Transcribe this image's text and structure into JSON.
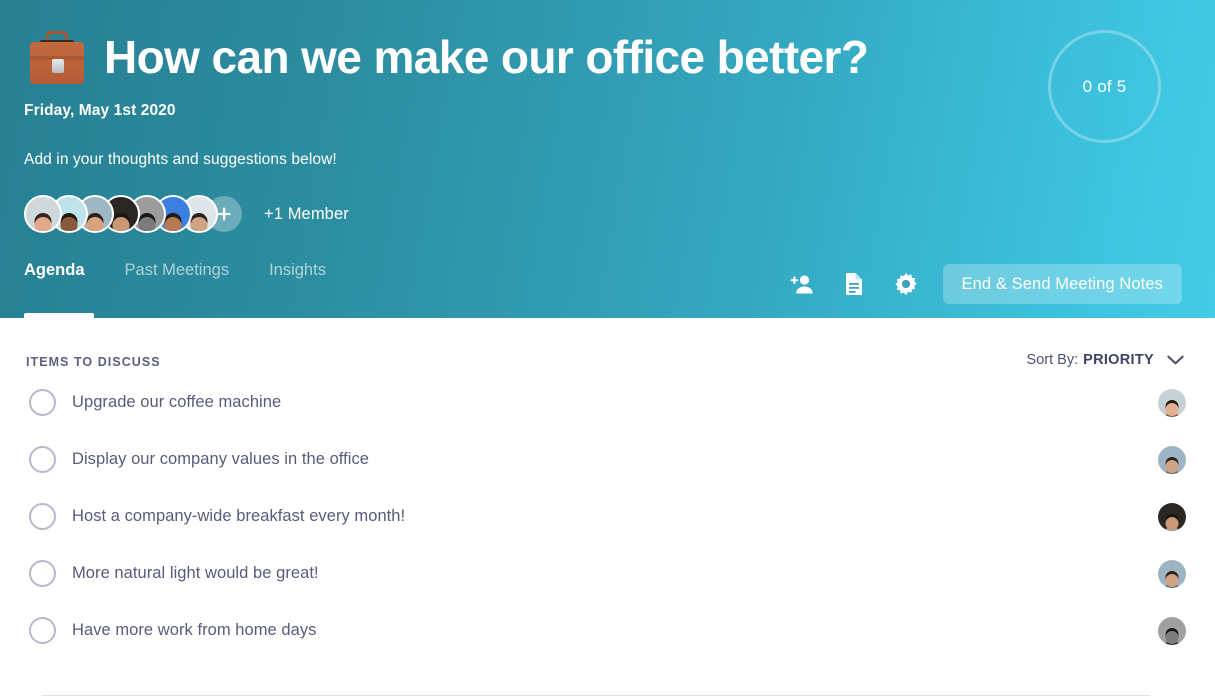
{
  "header": {
    "icon": "briefcase-icon",
    "title": "How can we make our office better?",
    "date": "Friday, May 1st 2020",
    "subtitle": "Add in your thoughts and suggestions below!",
    "progress_badge": "0 of 5",
    "members_count_label": "+1 Member",
    "add_member_icon": "plus-icon",
    "members": [
      {
        "name": "member-avatar-1",
        "skin": "#e0a98a",
        "hair": "#33261f",
        "shirt": "#a0785f",
        "bg": "#cfd8da"
      },
      {
        "name": "member-avatar-2",
        "skin": "#8a5a3c",
        "hair": "#241a14",
        "shirt": "#1f4f96",
        "bg": "#bfe3ea"
      },
      {
        "name": "member-avatar-3",
        "skin": "#d9a27c",
        "hair": "#2c2119",
        "shirt": "#6b6f73",
        "bg": "#9fb7c4"
      },
      {
        "name": "member-avatar-4",
        "skin": "#c99977",
        "hair": "#1c1611",
        "shirt": "#9aa2a8",
        "bg": "#2a2622"
      },
      {
        "name": "member-avatar-5",
        "skin": "#7b7b7b",
        "hair": "#1a1a1a",
        "shirt": "#2e2e2e",
        "bg": "#9c9c9c"
      },
      {
        "name": "member-avatar-6",
        "skin": "#b57a52",
        "hair": "#231a13",
        "shirt": "#2a6fd6",
        "bg": "#3c7fe0"
      },
      {
        "name": "member-avatar-7",
        "skin": "#cfa384",
        "hair": "#2a211c",
        "shirt": "#4a5258",
        "bg": "#dfe6ea"
      }
    ]
  },
  "tabs": [
    {
      "label": "Agenda",
      "active": true
    },
    {
      "label": "Past Meetings",
      "active": false
    },
    {
      "label": "Insights",
      "active": false
    }
  ],
  "toolbar": {
    "add_person_icon": "person-add-icon",
    "notes_icon": "document-icon",
    "settings_icon": "gear-icon",
    "end_send_label": "End & Send Meeting Notes"
  },
  "content": {
    "section_label": "ITEMS TO DISCUSS",
    "sort_label": "Sort By:",
    "sort_value": "PRIORITY",
    "sort_chevron_icon": "chevron-down-icon",
    "items": [
      {
        "text": "Upgrade our coffee machine",
        "checked": false,
        "avatar": {
          "skin": "#e3b091",
          "hair": "#241813",
          "shirt": "#7a5c49",
          "bg": "#c6d2d6"
        }
      },
      {
        "text": "Display our company values in the office",
        "checked": false,
        "avatar": {
          "skin": "#cfa384",
          "hair": "#2a211c",
          "shirt": "#5b6b74",
          "bg": "#9db4c2"
        }
      },
      {
        "text": "Host a company-wide breakfast every month!",
        "checked": false,
        "avatar": {
          "skin": "#c99977",
          "hair": "#1b1510",
          "shirt": "#9aa2a8",
          "bg": "#2b2723"
        }
      },
      {
        "text": "More natural light would be great!",
        "checked": false,
        "avatar": {
          "skin": "#cfa384",
          "hair": "#2a211c",
          "shirt": "#5b6b74",
          "bg": "#9db4c2"
        }
      },
      {
        "text": "Have more work from home days",
        "checked": false,
        "avatar": {
          "skin": "#7c7c7c",
          "hair": "#171717",
          "shirt": "#2c2c2c",
          "bg": "#a0a0a0"
        }
      }
    ]
  },
  "colors": {
    "gradient_start": "#277f92",
    "gradient_end": "#42cbe6",
    "text_primary": "#585b7c",
    "text_muted": "#5d6080",
    "checkbox_ring": "#b6b9ce",
    "divider": "#e2e3e8"
  }
}
